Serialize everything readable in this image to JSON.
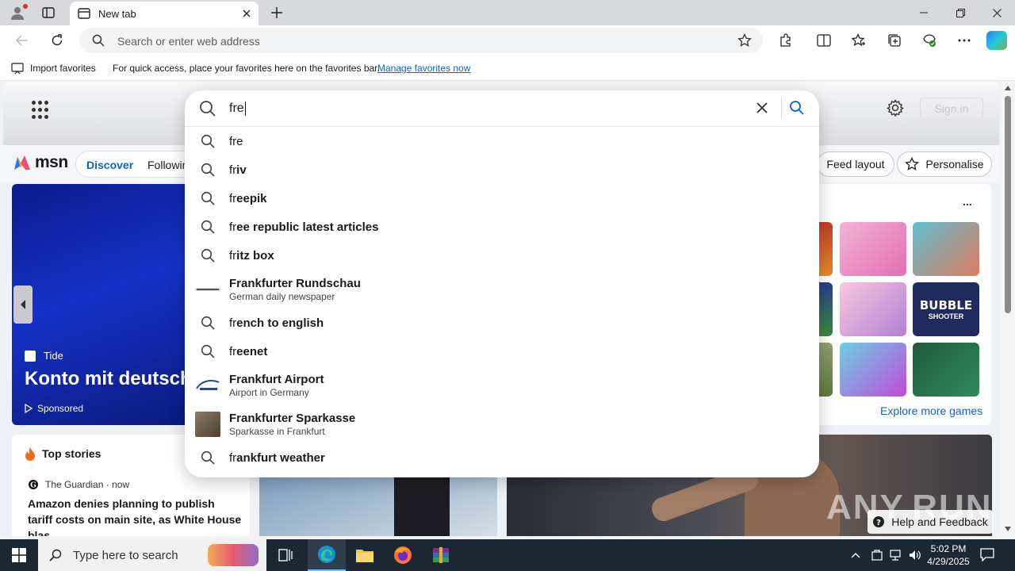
{
  "browser": {
    "tab_title": "New tab",
    "address_placeholder": "Search or enter web address"
  },
  "favorites_bar": {
    "import_label": "Import favorites",
    "message": "For quick access, place your favorites here on the favorites bar.",
    "manage_link": "Manage favorites now"
  },
  "msn": {
    "sign_in": "Sign in",
    "logo_text": "msn",
    "nav": {
      "discover": "Discover",
      "following": "Followin"
    },
    "feed_layout": "Feed layout",
    "personalise": "Personalise",
    "hero": {
      "source": "Tide",
      "title": "Konto mit deutsch",
      "sponsored": "Sponsored"
    },
    "games": {
      "more": "...",
      "explore": "Explore more games",
      "bubble_title": "BUBBLE",
      "bubble_sub": "SHOOTER"
    },
    "top_stories": {
      "heading": "Top stories",
      "source": "The Guardian · now",
      "headline": "Amazon denies planning to publish tariff costs on main site, as White House blas..."
    },
    "watermark": "ANY.RUN",
    "help": "Help and Feedback"
  },
  "search": {
    "query": "fre",
    "suggestions": [
      {
        "type": "query",
        "prefix": "fre",
        "rest": ""
      },
      {
        "type": "query",
        "prefix": "fr",
        "rest": "iv"
      },
      {
        "type": "query",
        "prefix": "fr",
        "rest": "eepik"
      },
      {
        "type": "query",
        "prefix": "fr",
        "rest": "ee republic latest articles"
      },
      {
        "type": "query",
        "prefix": "fr",
        "rest": "itz box"
      },
      {
        "type": "entity",
        "title": "Frankfurter Rundschau",
        "subtitle": "German daily newspaper"
      },
      {
        "type": "query",
        "prefix": "fr",
        "rest": "ench to english"
      },
      {
        "type": "query",
        "prefix": "fr",
        "rest": "eenet"
      },
      {
        "type": "entity",
        "title": "Frankfurt Airport",
        "subtitle": "Airport in Germany"
      },
      {
        "type": "entity",
        "title": "Frankfurter Sparkasse",
        "subtitle": "Sparkasse in Frankfurt"
      },
      {
        "type": "query",
        "prefix": "fr",
        "rest": "ankfurt weather"
      }
    ]
  },
  "taskbar": {
    "search_placeholder": "Type here to search",
    "time": "5:02 PM",
    "date": "4/29/2025"
  },
  "colors": {
    "accent": "#0f62c9",
    "msn_blue": "#0f62c9",
    "taskbar": "#1c2734"
  }
}
